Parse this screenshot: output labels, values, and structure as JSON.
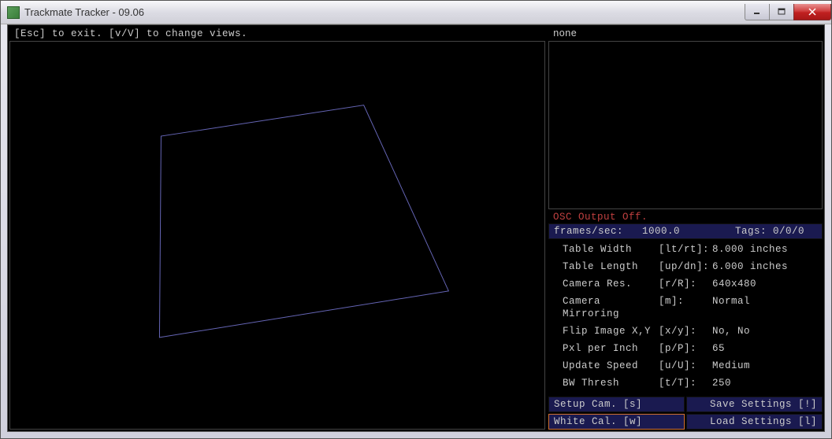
{
  "window": {
    "title": "Trackmate Tracker - 09.06"
  },
  "main": {
    "help_text": "[Esc] to exit.  [v/V] to change views.",
    "preview_label": "none"
  },
  "osc": {
    "status": "OSC Output Off."
  },
  "stats": {
    "fps_label": "frames/sec:",
    "fps_value": "1000.0",
    "tags_label": "Tags:",
    "tags_value": "0/0/0"
  },
  "settings": [
    {
      "label": "Table Width",
      "key": "[lt/rt]:",
      "value": "8.000 inches"
    },
    {
      "label": "Table Length",
      "key": "[up/dn]:",
      "value": "6.000 inches"
    },
    {
      "label": "Camera Res.",
      "key": "[r/R]:",
      "value": "640x480"
    },
    {
      "label": "Camera Mirroring",
      "key": "[m]:",
      "value": "Normal"
    },
    {
      "label": "Flip Image X,Y",
      "key": "[x/y]:",
      "value": "No, No"
    },
    {
      "label": "Pxl per Inch",
      "key": "[p/P]:",
      "value": "65"
    },
    {
      "label": "Update Speed",
      "key": "[u/U]:",
      "value": "Medium"
    },
    {
      "label": "BW Thresh",
      "key": "[t/T]:",
      "value": "250"
    }
  ],
  "buttons": {
    "setup_cam": "Setup Cam. [s]",
    "white_cal": "White Cal. [w]",
    "save_settings": "Save Settings [!]",
    "load_settings": "Load Settings [l]"
  }
}
